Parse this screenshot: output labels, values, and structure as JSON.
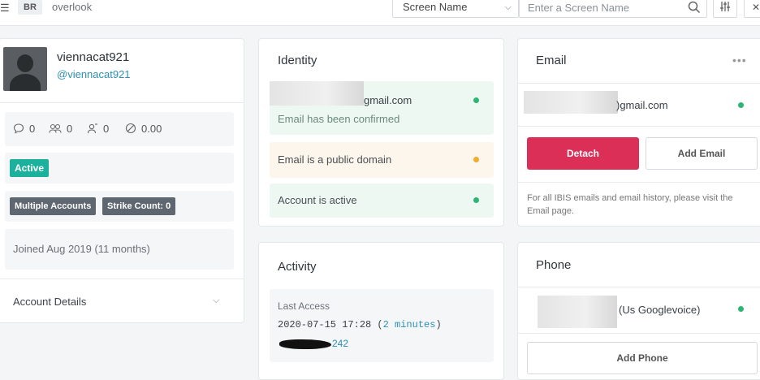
{
  "topbar": {
    "menu_icon": "hamburger-icon",
    "app_badge": "BR",
    "app_name": "overlook",
    "select_value": "Screen Name",
    "search_placeholder": "Enter a Screen Name",
    "filter_icon": "sliders-icon",
    "close_icon": "close-icon"
  },
  "profile": {
    "username": "viennacat921",
    "handle": "@viennacat921",
    "stats": [
      {
        "icon": "comment-icon",
        "value": "0"
      },
      {
        "icon": "users-icon",
        "value": "0"
      },
      {
        "icon": "user-icon",
        "value": "0"
      },
      {
        "icon": "ban-icon",
        "value": "0.00"
      }
    ],
    "status_badge": "Active",
    "tags": [
      "Multiple Accounts",
      "Strike Count: 0"
    ],
    "joined": "Joined Aug 2019 (11 months)",
    "account_details_label": "Account Details"
  },
  "identity": {
    "title": "Identity",
    "email_suffix": "gmail.com",
    "email_status": "Email has been confirmed",
    "public_domain": "Email is a public domain",
    "account_active": "Account is active",
    "colors": {
      "green": "#2bb673",
      "orange": "#f0ad2e"
    }
  },
  "activity": {
    "title": "Activity",
    "last_access_label": "Last Access",
    "last_access_time": "2020-07-15 17:28",
    "last_access_relative": "2 minutes",
    "ip_suffix": "242"
  },
  "email": {
    "title": "Email",
    "more_icon": "more-icon",
    "address_suffix": ")gmail.com",
    "detach_label": "Detach",
    "add_label": "Add Email",
    "note": "For all IBIS emails and email history, please visit the Email page."
  },
  "phone": {
    "title": "Phone",
    "carrier": "(Us Googlevoice)",
    "add_label": "Add Phone"
  }
}
